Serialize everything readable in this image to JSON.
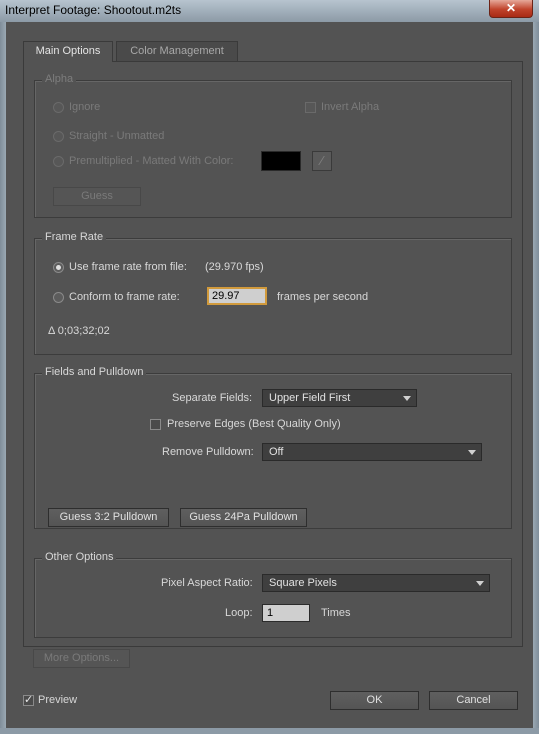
{
  "window": {
    "title": "Interpret Footage: Shootout.m2ts",
    "close_label": "✕"
  },
  "tabs": [
    {
      "label": "Main Options",
      "active": true
    },
    {
      "label": "Color Management",
      "active": false
    }
  ],
  "alpha": {
    "label": "Alpha",
    "ignore": "Ignore",
    "invert": "Invert Alpha",
    "straight": "Straight - Unmatted",
    "premultiplied": "Premultiplied - Matted With Color:",
    "matte_color": "#000000",
    "eyedropper_icon": "eyedropper-icon",
    "guess": "Guess"
  },
  "frame_rate": {
    "label": "Frame Rate",
    "use_file": "Use frame rate from file:",
    "file_fps": "(29.970 fps)",
    "conform": "Conform to frame rate:",
    "conform_value": "29.97",
    "units": "frames per second",
    "duration": "Δ 0;03;32;02"
  },
  "fields": {
    "label": "Fields and Pulldown",
    "separate_label": "Separate Fields:",
    "separate_value": "Upper Field First",
    "preserve_edges": "Preserve Edges (Best Quality Only)",
    "remove_label": "Remove Pulldown:",
    "remove_value": "Off",
    "guess32": "Guess 3:2 Pulldown",
    "guess24": "Guess 24Pa Pulldown"
  },
  "other": {
    "label": "Other Options",
    "par_label": "Pixel Aspect Ratio:",
    "par_value": "Square Pixels",
    "loop_label": "Loop:",
    "loop_value": "1",
    "times": "Times"
  },
  "more_options": "More Options...",
  "footer": {
    "preview": "Preview",
    "preview_checked": true,
    "ok": "OK",
    "cancel": "Cancel"
  }
}
